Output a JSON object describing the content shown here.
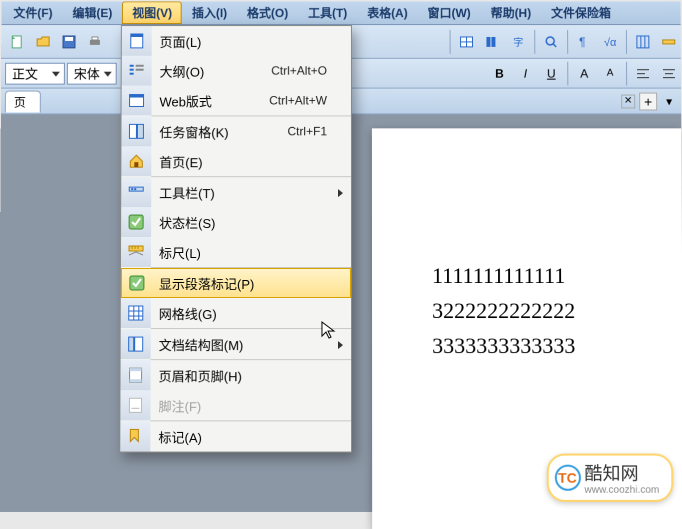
{
  "menubar": {
    "file": "文件(F)",
    "edit": "编辑(E)",
    "view": "视图(V)",
    "insert": "插入(I)",
    "format": "格式(O)",
    "tools": "工具(T)",
    "table": "表格(A)",
    "window": "窗口(W)",
    "help": "帮助(H)",
    "safebox": "文件保险箱"
  },
  "format": {
    "style": "正文",
    "font": "宋体"
  },
  "tab": {
    "label": "页"
  },
  "dropdown": {
    "items": [
      {
        "label": "页面(L)",
        "shortcut": "",
        "icon": "page",
        "submenu": false
      },
      {
        "label": "大纲(O)",
        "shortcut": "Ctrl+Alt+O",
        "icon": "outline",
        "submenu": false
      },
      {
        "label": "Web版式",
        "shortcut": "Ctrl+Alt+W",
        "icon": "web",
        "submenu": false
      },
      {
        "label": "任务窗格(K)",
        "shortcut": "Ctrl+F1",
        "icon": "taskpane",
        "submenu": false,
        "sep_before": true
      },
      {
        "label": "首页(E)",
        "shortcut": "",
        "icon": "home",
        "submenu": false
      },
      {
        "label": "工具栏(T)",
        "shortcut": "",
        "icon": "toolbar",
        "submenu": true,
        "sep_before": true
      },
      {
        "label": "状态栏(S)",
        "shortcut": "",
        "icon": "check",
        "submenu": false
      },
      {
        "label": "标尺(L)",
        "shortcut": "",
        "icon": "ruler",
        "submenu": false
      },
      {
        "label": "显示段落标记(P)",
        "shortcut": "",
        "icon": "check",
        "submenu": false,
        "highlight": true,
        "sep_before": true
      },
      {
        "label": "网格线(G)",
        "shortcut": "",
        "icon": "grid",
        "submenu": false
      },
      {
        "label": "文档结构图(M)",
        "shortcut": "",
        "icon": "structure",
        "submenu": true,
        "sep_before": true
      },
      {
        "label": "页眉和页脚(H)",
        "shortcut": "",
        "icon": "headerfooter",
        "submenu": false,
        "sep_before": true
      },
      {
        "label": "脚注(F)",
        "shortcut": "",
        "icon": "footnote",
        "submenu": false,
        "disabled": true
      },
      {
        "label": "标记(A)",
        "shortcut": "",
        "icon": "mark",
        "submenu": false,
        "sep_before": true
      }
    ]
  },
  "document": {
    "lines": [
      "1111111111111",
      "3222222222222",
      "3333333333333"
    ]
  },
  "watermark": {
    "text": "酷知网",
    "url": "www.coozhi.com",
    "logo": "TC"
  }
}
